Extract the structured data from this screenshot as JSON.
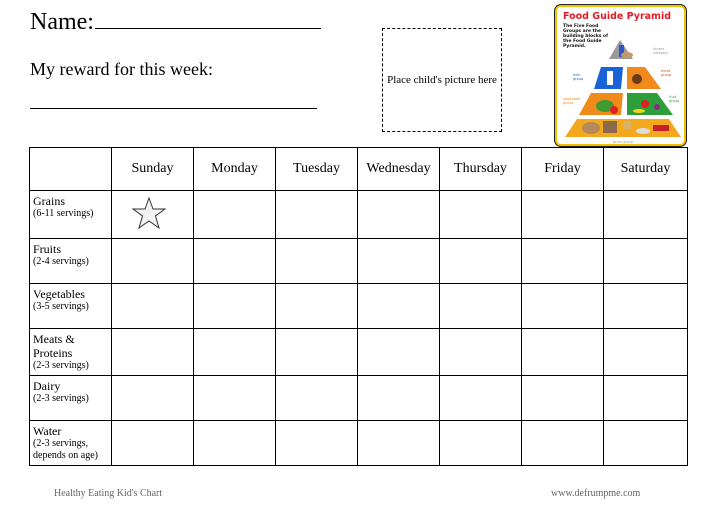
{
  "header": {
    "name_label": "Name:",
    "reward_label": "My reward for this week:",
    "photo_placeholder": "Place child's picture here"
  },
  "pyramid_image": {
    "title": "Food Guide Pyramid",
    "description": "The Five Food Groups are the building blocks of the Food Guide Pyramid.",
    "labels": {
      "others": "others category",
      "milk": "milk group",
      "meat": "meat group",
      "vegetable": "vegetable group",
      "fruit": "fruit group",
      "grain": "grain group"
    },
    "colors": {
      "border": "#f2c200",
      "title": "#e31b23",
      "milk": "#1a63d6",
      "meat": "#f08a1c",
      "vegetable": "#f08a1c",
      "fruit": "#2e9e3a",
      "grain": "#f4a81d"
    }
  },
  "table": {
    "days": [
      "Sunday",
      "Monday",
      "Tuesday",
      "Wednesday",
      "Thursday",
      "Friday",
      "Saturday"
    ],
    "rows": [
      {
        "name": "Grains",
        "servings": "(6-11 servings)",
        "marks": [
          "star",
          "",
          "",
          "",
          "",
          "",
          ""
        ]
      },
      {
        "name": "Fruits",
        "servings": "(2-4 servings)",
        "marks": [
          "",
          "",
          "",
          "",
          "",
          "",
          ""
        ]
      },
      {
        "name": "Vegetables",
        "servings": "(3-5 servings)",
        "marks": [
          "",
          "",
          "",
          "",
          "",
          "",
          ""
        ]
      },
      {
        "name": "Meats & Proteins",
        "servings": "(2-3 servings)",
        "marks": [
          "",
          "",
          "",
          "",
          "",
          "",
          ""
        ]
      },
      {
        "name": "Dairy",
        "servings": "(2-3 servings)",
        "marks": [
          "",
          "",
          "",
          "",
          "",
          "",
          ""
        ]
      },
      {
        "name": "Water",
        "servings": "(2-3 servings, depends on age)",
        "marks": [
          "",
          "",
          "",
          "",
          "",
          "",
          ""
        ]
      }
    ]
  },
  "footer": {
    "left": "Healthy Eating Kid's Chart",
    "right": "www.defrumpme.com"
  }
}
